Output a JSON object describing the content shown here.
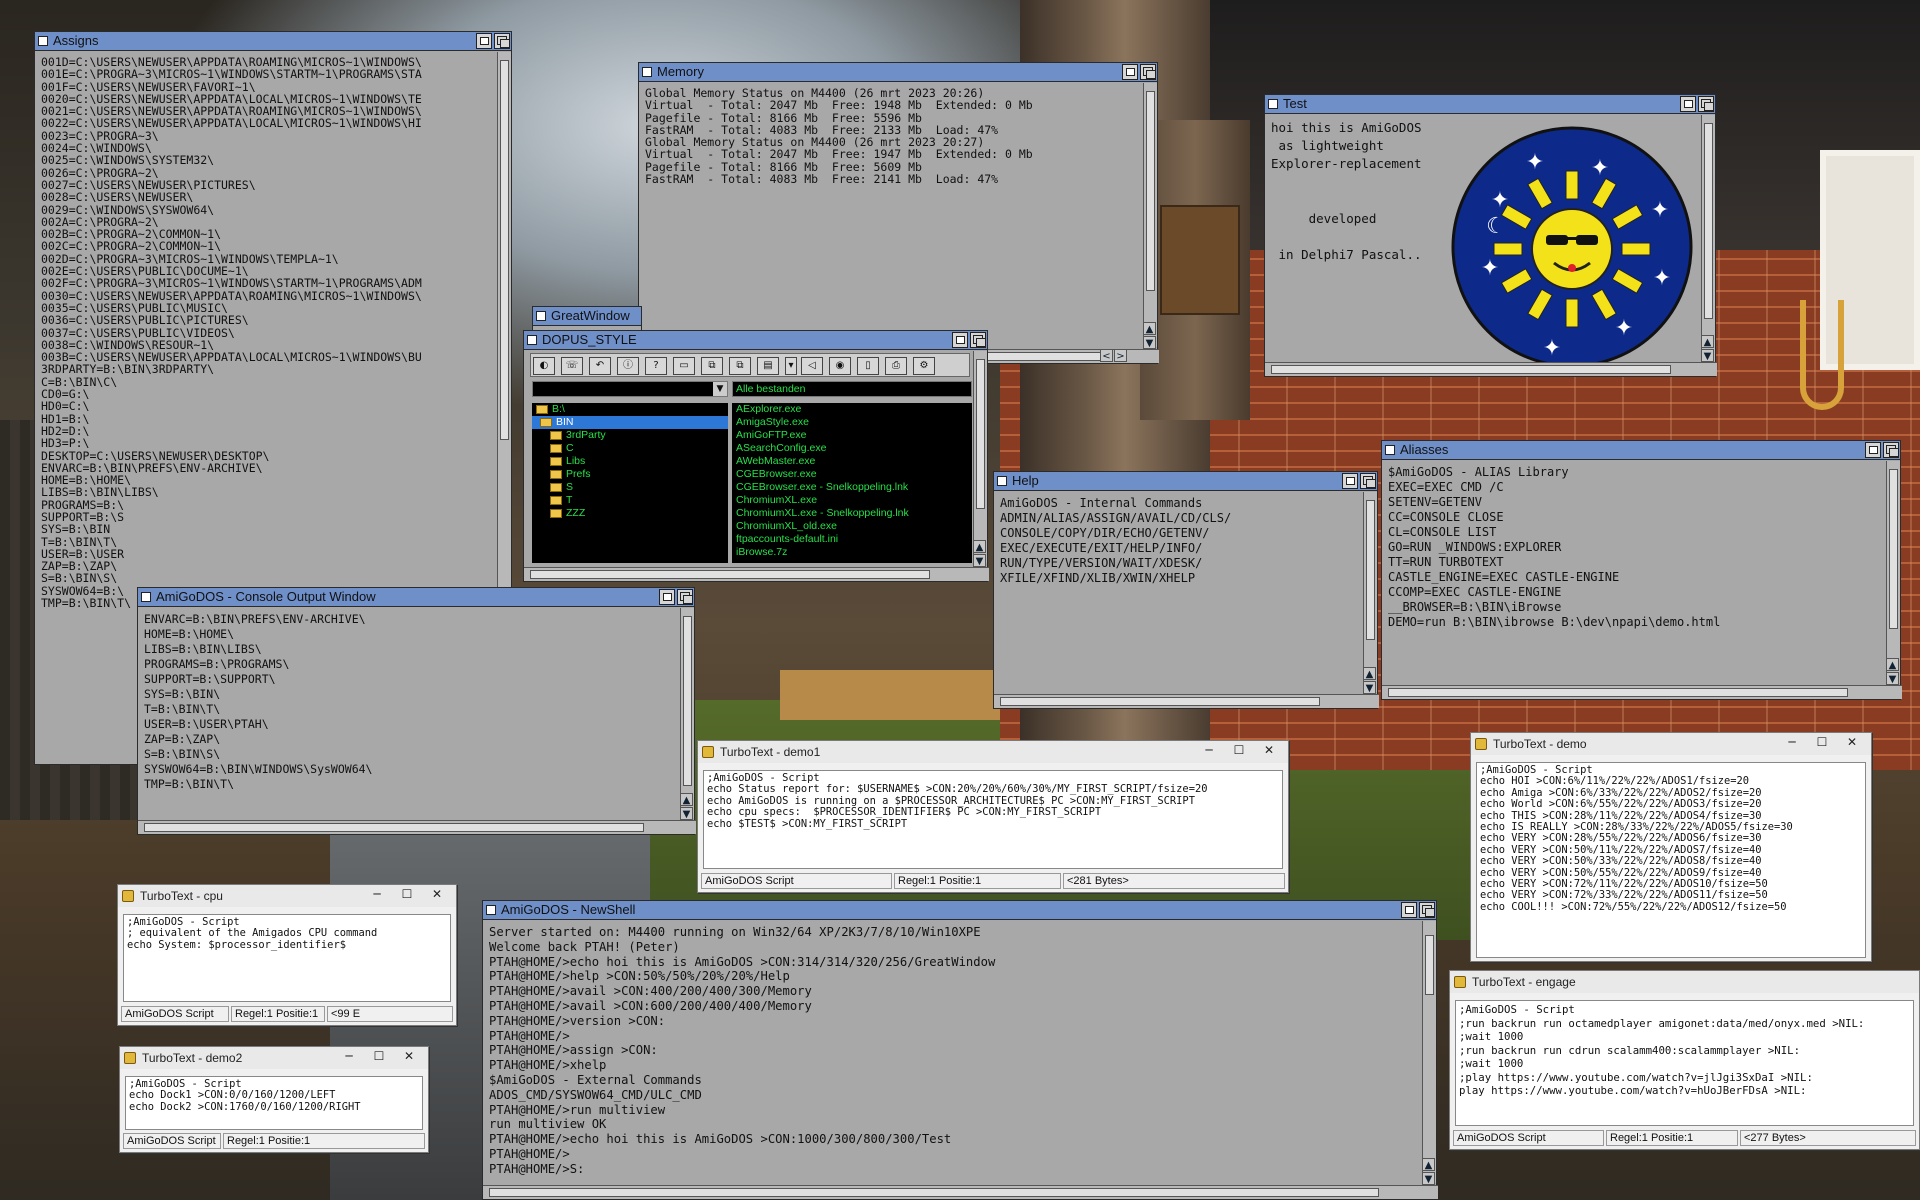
{
  "windows": {
    "assigns": {
      "title": "Assigns",
      "lines": [
        "001D=C:\\USERS\\NEWUSER\\APPDATA\\ROAMING\\MICROS~1\\WINDOWS\\",
        "001E=C:\\PROGRA~3\\MICROS~1\\WINDOWS\\STARTM~1\\PROGRAMS\\STA",
        "001F=C:\\USERS\\NEWUSER\\FAVORI~1\\",
        "0020=C:\\USERS\\NEWUSER\\APPDATA\\LOCAL\\MICROS~1\\WINDOWS\\TE",
        "0021=C:\\USERS\\NEWUSER\\APPDATA\\ROAMING\\MICROS~1\\WINDOWS\\",
        "0022=C:\\USERS\\NEWUSER\\APPDATA\\LOCAL\\MICROS~1\\WINDOWS\\HI",
        "0023=C:\\PROGRA~3\\",
        "0024=C:\\WINDOWS\\",
        "0025=C:\\WINDOWS\\SYSTEM32\\",
        "0026=C:\\PROGRA~2\\",
        "0027=C:\\USERS\\NEWUSER\\PICTURES\\",
        "0028=C:\\USERS\\NEWUSER\\",
        "0029=C:\\WINDOWS\\SYSWOW64\\",
        "002A=C:\\PROGRA~2\\",
        "002B=C:\\PROGRA~2\\COMMON~1\\",
        "002C=C:\\PROGRA~2\\COMMON~1\\",
        "002D=C:\\PROGRA~3\\MICROS~1\\WINDOWS\\TEMPLA~1\\",
        "002E=C:\\USERS\\PUBLIC\\DOCUME~1\\",
        "002F=C:\\PROGRA~3\\MICROS~1\\WINDOWS\\STARTM~1\\PROGRAMS\\ADM",
        "0030=C:\\USERS\\NEWUSER\\APPDATA\\ROAMING\\MICROS~1\\WINDOWS\\",
        "0035=C:\\USERS\\PUBLIC\\MUSIC\\",
        "0036=C:\\USERS\\PUBLIC\\PICTURES\\",
        "0037=C:\\USERS\\PUBLIC\\VIDEOS\\",
        "0038=C:\\WINDOWS\\RESOUR~1\\",
        "003B=C:\\USERS\\NEWUSER\\APPDATA\\LOCAL\\MICROS~1\\WINDOWS\\BU",
        "3RDPARTY=B:\\BIN\\3RDPARTY\\",
        "C=B:\\BIN\\C\\",
        "CD0=G:\\",
        "HD0=C:\\",
        "HD1=B:\\",
        "HD2=D:\\",
        "HD3=P:\\",
        "DESKTOP=C:\\USERS\\NEWUSER\\DESKTOP\\",
        "ENVARC=B:\\BIN\\PREFS\\ENV-ARCHIVE\\",
        "HOME=B:\\HOME\\",
        "LIBS=B:\\BIN\\LIBS\\",
        "PROGRAMS=B:\\",
        "SUPPORT=B:\\S",
        "SYS=B:\\BIN",
        "T=B:\\BIN\\T\\",
        "USER=B:\\USER",
        "ZAP=B:\\ZAP\\",
        "S=B:\\BIN\\S\\",
        "SYSWOW64=B:\\",
        "TMP=B:\\BIN\\T\\"
      ]
    },
    "memory": {
      "title": "Memory",
      "lines": [
        "Global Memory Status on M4400 (26 mrt 2023 20:26)",
        "Virtual  - Total: 2047 Mb  Free: 1948 Mb  Extended: 0 Mb",
        "Pagefile - Total: 8166 Mb  Free: 5596 Mb",
        "FastRAM  - Total: 4083 Mb  Free: 2133 Mb  Load: 47%",
        "Global Memory Status on M4400 (26 mrt 2023 20:27)",
        "Virtual  - Total: 2047 Mb  Free: 1947 Mb  Extended: 0 Mb",
        "Pagefile - Total: 8166 Mb  Free: 5609 Mb",
        "FastRAM  - Total: 4083 Mb  Free: 2141 Mb  Load: 47%"
      ]
    },
    "test": {
      "title": "Test",
      "lines": [
        "hoi this is AmiGoDOS",
        " as lightweight",
        "Explorer-replacement",
        "",
        "",
        "     developed",
        "",
        " in Delphi7 Pascal.."
      ]
    },
    "greatwindow": {
      "title": "GreatWindow"
    },
    "dopus": {
      "title": "DOPUS_STYLE",
      "right_path": "Alle bestanden",
      "folders": [
        "B:\\",
        "BIN",
        "3rdParty",
        "C",
        "Libs",
        "Prefs",
        "S",
        "T",
        "ZZZ"
      ],
      "files": [
        "AExplorer.exe",
        "AmigaStyle.exe",
        "AmiGoFTP.exe",
        "ASearchConfig.exe",
        "AWebMaster.exe",
        "CGEBrowser.exe",
        "CGEBrowser.exe - Snelkoppeling.lnk",
        "ChromiumXL.exe",
        "ChromiumXL.exe - Snelkoppeling.lnk",
        "ChromiumXL_old.exe",
        "ftpaccounts-default.ini",
        "iBrowse.7z"
      ]
    },
    "help": {
      "title": "Help",
      "lines": [
        "AmiGoDOS - Internal Commands",
        "ADMIN/ALIAS/ASSIGN/AVAIL/CD/CLS/",
        "CONSOLE/COPY/DIR/ECHO/GETENV/",
        "EXEC/EXECUTE/EXIT/HELP/INFO/",
        "RUN/TYPE/VERSION/WAIT/XDESK/",
        "XFILE/XFIND/XLIB/XWIN/XHELP"
      ]
    },
    "aliasses": {
      "title": "Aliasses",
      "lines": [
        "$AmiGoDOS - ALIAS Library",
        "EXEC=EXEC CMD /C",
        "SETENV=GETENV",
        "CC=CONSOLE CLOSE",
        "CL=CONSOLE LIST",
        "GO=RUN _WINDOWS:EXPLORER",
        "TT=RUN TURBOTEXT",
        "CASTLE_ENGINE=EXEC CASTLE-ENGINE",
        "CCOMP=EXEC CASTLE-ENGINE",
        "__BROWSER=B:\\BIN\\iBrowse",
        "DEMO=run B:\\BIN\\ibrowse B:\\dev\\npapi\\demo.html"
      ]
    },
    "console": {
      "title": "AmiGoDOS - Console Output Window",
      "lines": [
        "ENVARC=B:\\BIN\\PREFS\\ENV-ARCHIVE\\",
        "HOME=B:\\HOME\\",
        "LIBS=B:\\BIN\\LIBS\\",
        "PROGRAMS=B:\\PROGRAMS\\",
        "SUPPORT=B:\\SUPPORT\\",
        "SYS=B:\\BIN\\",
        "T=B:\\BIN\\T\\",
        "USER=B:\\USER\\PTAH\\",
        "ZAP=B:\\ZAP\\",
        "S=B:\\BIN\\S\\",
        "SYSWOW64=B:\\BIN\\WINDOWS\\SysWOW64\\",
        "TMP=B:\\BIN\\T\\"
      ]
    },
    "newshell": {
      "title": "AmiGoDOS - NewShell",
      "lines": [
        "Server started on: M4400 running on Win32/64 XP/2K3/7/8/10/Win10XPE",
        "Welcome back PTAH! (Peter)",
        "PTAH@HOME/>echo hoi this is AmiGoDOS >CON:314/314/320/256/GreatWindow",
        "PTAH@HOME/>help >CON:50%/50%/20%/20%/Help",
        "PTAH@HOME/>avail >CON:400/200/400/300/Memory",
        "PTAH@HOME/>avail >CON:600/200/400/400/Memory",
        "PTAH@HOME/>version >CON:",
        "PTAH@HOME/>",
        "PTAH@HOME/>assign >CON:",
        "PTAH@HOME/>xhelp",
        "$AmiGoDOS - External Commands",
        "ADOS_CMD/SYSWOW64_CMD/ULC_CMD",
        "PTAH@HOME/>run multiview",
        "run multiview OK",
        "PTAH@HOME/>echo hoi this is AmiGoDOS >CON:1000/300/800/300/Test",
        "PTAH@HOME/>",
        "PTAH@HOME/>S:"
      ]
    },
    "tt_demo1": {
      "title": "TurboText - demo1",
      "lines": [
        ";AmiGoDOS - Script",
        "echo Status report for: $USERNAME$ >CON:20%/20%/60%/30%/MY_FIRST_SCRIPT/fsize=20",
        "echo AmiGoDOS is running on a $PROCESSOR_ARCHITECTURE$ PC >CON:MY_FIRST_SCRIPT",
        "echo cpu specs:  $PROCESSOR_IDENTIFIER$ PC >CON:MY_FIRST_SCRIPT",
        "echo $TEST$ >CON:MY_FIRST_SCRIPT"
      ],
      "status": [
        "AmiGoDOS Script",
        "Regel:1 Positie:1",
        "<281 Bytes>"
      ]
    },
    "tt_demo": {
      "title": "TurboText - demo",
      "lines": [
        ";AmiGoDOS - Script",
        "echo HOI >CON:6%/11%/22%/22%/ADOS1/fsize=20",
        "echo Amiga >CON:6%/33%/22%/22%/ADOS2/fsize=20",
        "echo World >CON:6%/55%/22%/22%/ADOS3/fsize=20",
        "echo THIS >CON:28%/11%/22%/22%/ADOS4/fsize=30",
        "echo IS REALLY >CON:28%/33%/22%/22%/ADOS5/fsize=30",
        "echo VERY >CON:28%/55%/22%/22%/ADOS6/fsize=30",
        "echo VERY >CON:50%/11%/22%/22%/ADOS7/fsize=40",
        "echo VERY >CON:50%/33%/22%/22%/ADOS8/fsize=40",
        "echo VERY >CON:50%/55%/22%/22%/ADOS9/fsize=40",
        "echo VERY >CON:72%/11%/22%/22%/ADOS10/fsize=50",
        "echo VERY >CON:72%/33%/22%/22%/ADOS11/fsize=50",
        "echo COOL!!! >CON:72%/55%/22%/22%/ADOS12/fsize=50"
      ]
    },
    "tt_engage": {
      "title": "TurboText - engage",
      "lines": [
        ";AmiGoDOS - Script",
        ";run backrun run octamedplayer amigonet:data/med/onyx.med >NIL:",
        ";wait 1000",
        ";run backrun run cdrun scalamm400:scalammplayer >NIL:",
        ";wait 1000",
        ";play https://www.youtube.com/watch?v=jlJgi3SxDaI >NIL:",
        "play https://www.youtube.com/watch?v=hUoJBerFDsA >NIL:"
      ],
      "status": [
        "AmiGoDOS Script",
        "Regel:1 Positie:1",
        "<277 Bytes>"
      ]
    },
    "tt_cpu": {
      "title": "TurboText - cpu",
      "lines": [
        ";AmiGoDOS - Script",
        "; equivalent of the Amigados CPU command",
        "echo System: $processor_identifier$"
      ],
      "status": [
        "AmiGoDOS Script",
        "Regel:1 Positie:1",
        "<99 E"
      ]
    },
    "tt_demo2": {
      "title": "TurboText - demo2",
      "lines": [
        ";AmiGoDOS - Script",
        "echo Dock1 >CON:0/0/160/1200/LEFT",
        "echo Dock2 >CON:1760/0/160/1200/RIGHT"
      ],
      "status": [
        "AmiGoDOS Script",
        "Regel:1 Positie:1"
      ]
    }
  },
  "icons": [
    "sun-logo",
    "folder-icon",
    "zoom-gadget",
    "depth-gadget",
    "close-gadget"
  ],
  "colors": {
    "titlebar": "#6f8fc8",
    "window_bg": "#a8a8a8",
    "dopus_green": "#27e04a",
    "logo_blue": "#0d2a8a",
    "logo_yellow": "#f3e21a"
  }
}
